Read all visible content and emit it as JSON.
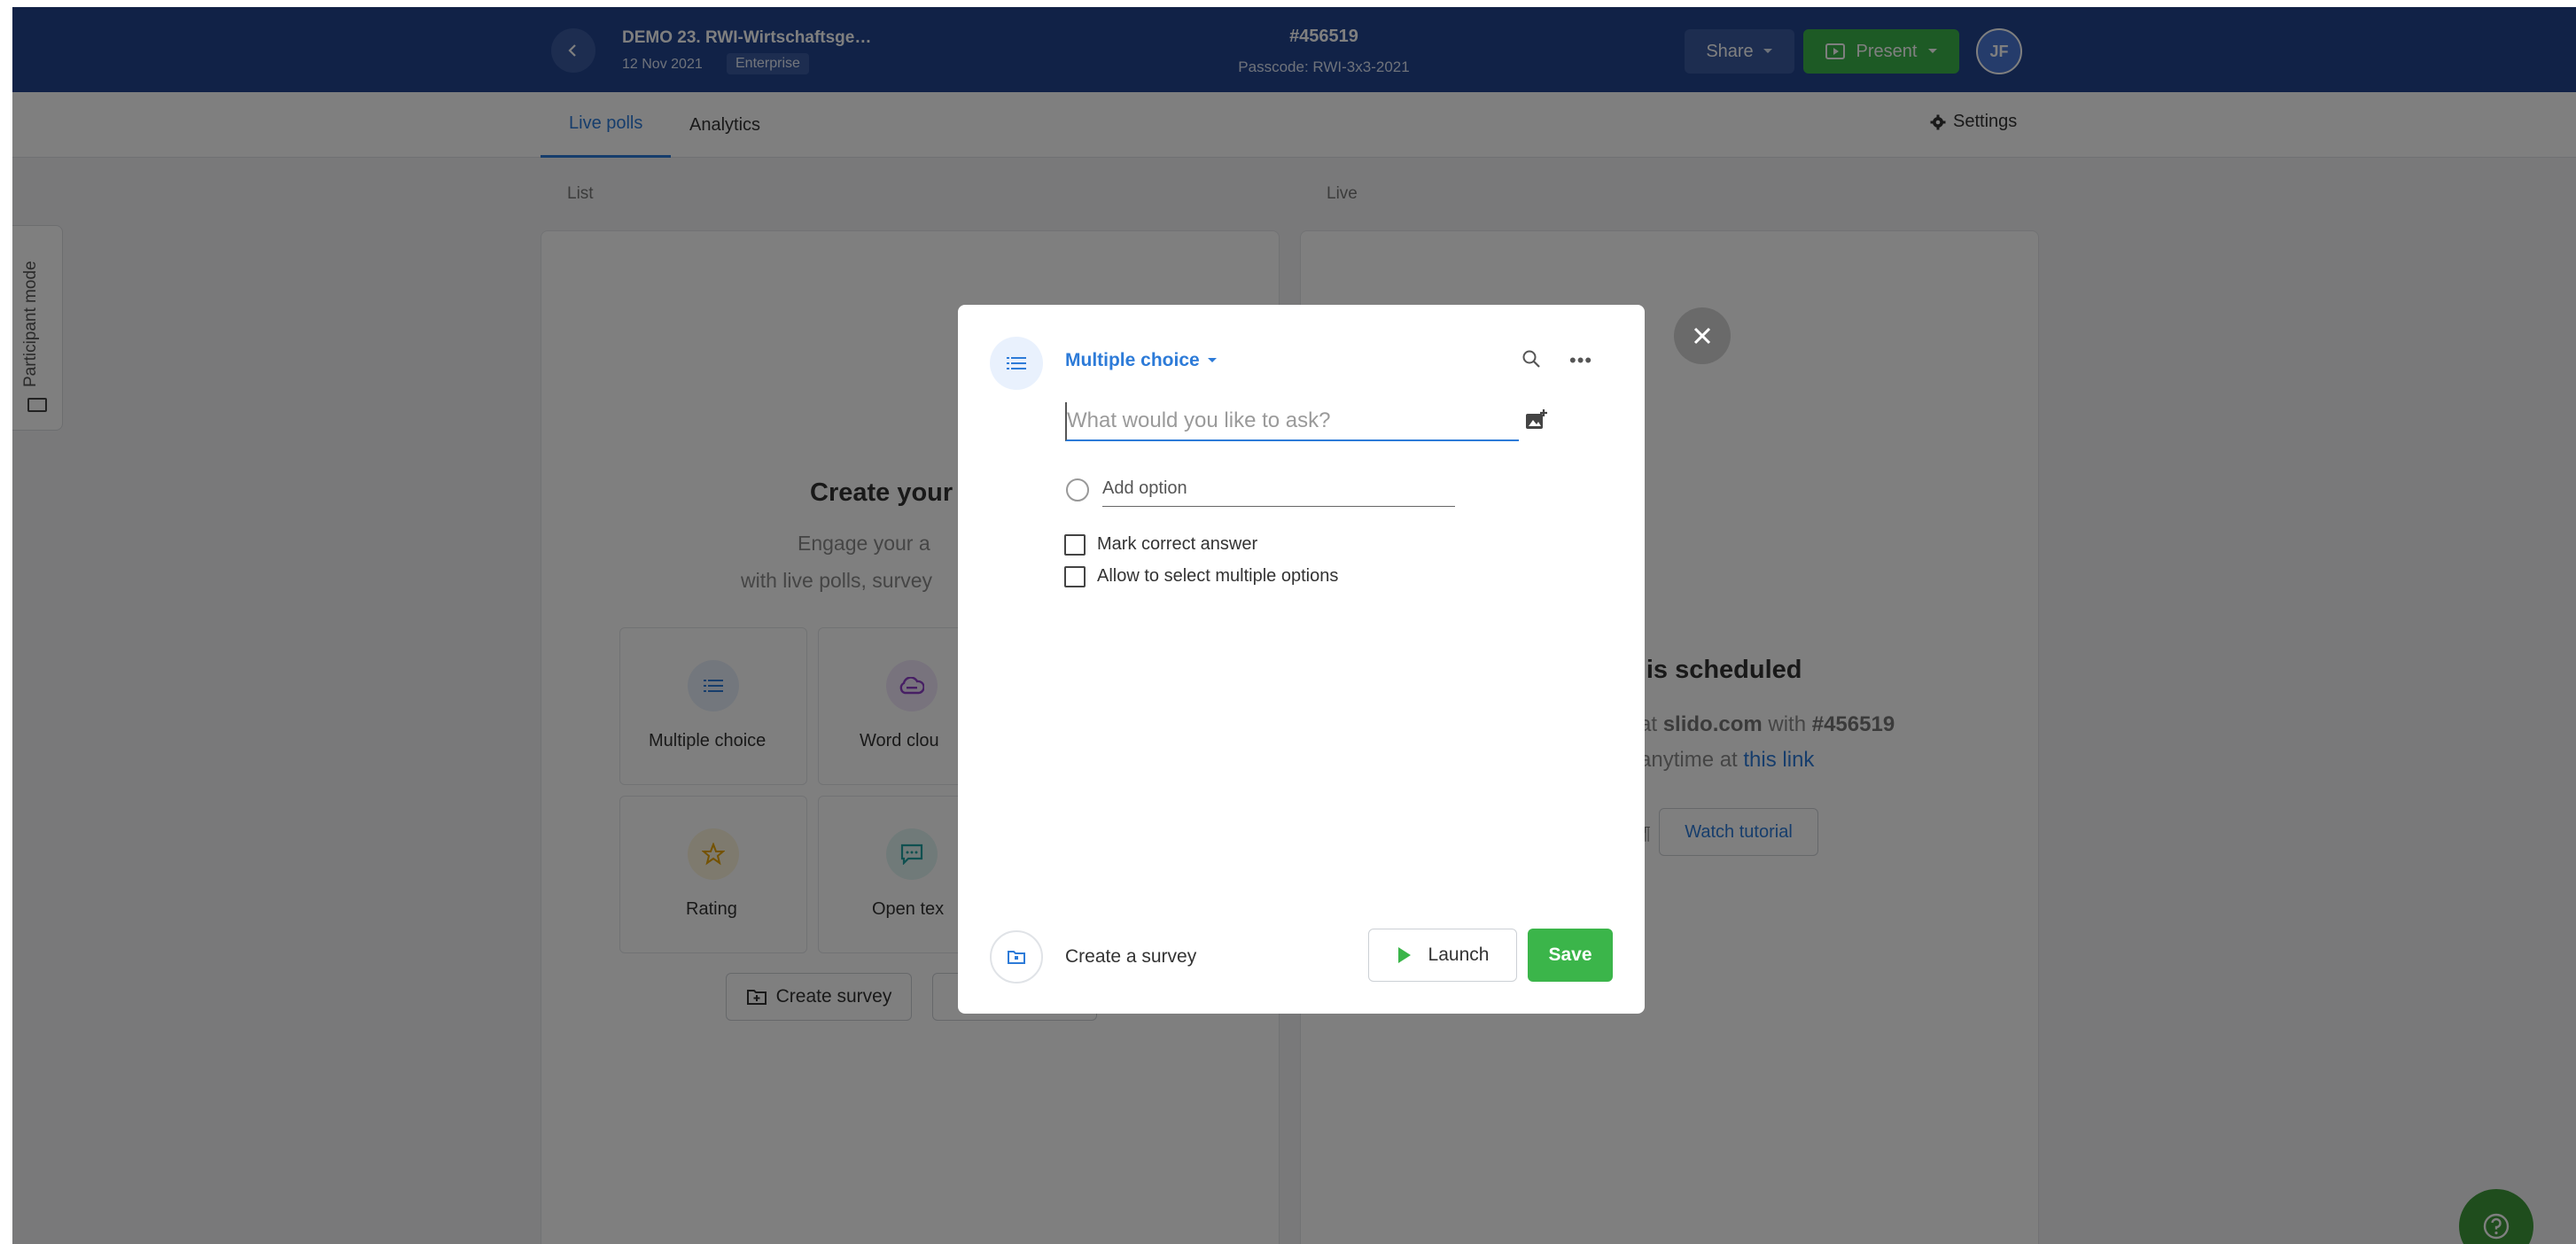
{
  "header": {
    "event_title": "DEMO 23. RWI-Wirtschaftsge…",
    "event_date": "12 Nov 2021",
    "plan_badge": "Enterprise",
    "event_code": "#456519",
    "passcode": "Passcode: RWI-3x3-2021",
    "share_label": "Share",
    "present_label": "Present",
    "avatar_initials": "JF"
  },
  "tabs": {
    "live_polls": "Live polls",
    "analytics": "Analytics",
    "settings": "Settings"
  },
  "list_section": {
    "label": "List",
    "title": "Create your",
    "subtitle_line1": "Engage your a",
    "subtitle_line2": "with live polls, survey",
    "cards": [
      {
        "label": "Multiple choice",
        "icon": "list-icon",
        "color": "#2d7bd8"
      },
      {
        "label": "Word clou",
        "icon": "cloud-icon",
        "color": "#8e3fc9"
      },
      {
        "label": "Rating",
        "icon": "star-icon",
        "color": "#e8a400"
      },
      {
        "label": "Open tex",
        "icon": "chat-icon",
        "color": "#21a0a0"
      }
    ],
    "create_survey_label": "Create survey"
  },
  "live_section": {
    "label": "Live",
    "title": "lo is scheduled",
    "line1_prefix": "at ",
    "line1_site": "slido.com",
    "line1_mid": " with ",
    "line1_code": "#456519",
    "line2_prefix": "anytime at ",
    "line2_link": "this link",
    "watch_tutorial": "Watch tutorial",
    "para_mark": "¶"
  },
  "sidebar": {
    "participant_mode": "Participant mode"
  },
  "modal": {
    "poll_type": "Multiple choice",
    "question_placeholder": "What would you like to ask?",
    "question_value": "",
    "option_placeholder": "Add option",
    "mark_correct_label": "Mark correct answer",
    "allow_multiple_label": "Allow to select multiple options",
    "create_survey_label": "Create a survey",
    "launch_label": "Launch",
    "save_label": "Save"
  },
  "colors": {
    "header_bg": "#23458f",
    "accent_blue": "#2d7bd8",
    "green": "#3bb54a"
  }
}
